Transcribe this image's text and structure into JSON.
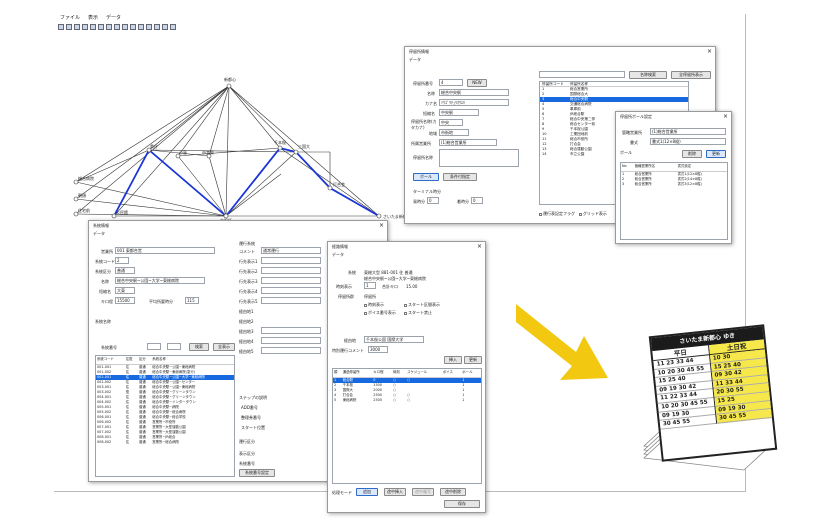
{
  "menubar": [
    "ファイル",
    "表示",
    "データ"
  ],
  "toolbar_icons": [
    "new-icon",
    "open-icon",
    "save-icon",
    "copy-icon",
    "cut-icon",
    "paste-icon",
    "settings-icon",
    "list-icon",
    "map-icon",
    "edit-icon",
    "delete-icon",
    "grid-icon",
    "search-icon",
    "window-icon",
    "user-icon"
  ],
  "map": {
    "nodes": {
      "n1": "新都心",
      "n2": "さいたま新都心",
      "n3": "千本桜",
      "n4": "三国大",
      "n5": "打合会",
      "n6": "市役所",
      "n7": "県庁",
      "n8": "小島",
      "n9": "市営東",
      "n10": "新都会場",
      "n11": "総合病院",
      "n12": "朝顔",
      "n13": "住宅前",
      "n14": "公民館",
      "n15": "総合運"
    }
  },
  "stop_dialog": {
    "title": "停留所情報",
    "subtitle": "データ",
    "fields": {
      "stop_no_label": "停留所番号",
      "stop_no": "4",
      "new_btn": "NEW",
      "name_label": "名称",
      "name": "総合中央駅",
      "kana_label": "カナ名",
      "kana": "ｿｳｺﾞｳﾁｭｳｵｳｴｷ",
      "short_label": "短縮名",
      "short": "中央駅",
      "short2_label": "停留所名称(カタカナ)",
      "short2": "中央",
      "region_label": "地域",
      "region": "市街地",
      "company_label": "所属営業所",
      "company": "(1)総合営業所",
      "note_label": "停留所名称"
    },
    "buttons": {
      "all": "ボール",
      "detail": "条件付指定"
    },
    "search_btn": "名称検索",
    "all_stops_btn": "全停留所表示",
    "bottom": {
      "label": "ターミナル時分",
      "arr_label": "発時分",
      "arr": "0",
      "dep_label": "着時分",
      "dep": "0"
    },
    "checks": [
      "運行表記定フラグ",
      "グリッド表示"
    ],
    "list_headers": [
      "停留所コード",
      "停留所名称"
    ],
    "list": [
      {
        "code": "1",
        "name": "総合営業所"
      },
      {
        "code": "2",
        "name": "国際総合大"
      },
      {
        "code": "3",
        "name": "総合中央駅"
      },
      {
        "code": "4",
        "name": "交通総合病院"
      },
      {
        "code": "5",
        "name": "車庫前"
      },
      {
        "code": "6",
        "name": "JR総合駅"
      },
      {
        "code": "7",
        "name": "総合中央第二停"
      },
      {
        "code": "8",
        "name": "総合センター前"
      },
      {
        "code": "9",
        "name": "千本桜公園"
      },
      {
        "code": "10",
        "name": "工業団地前"
      },
      {
        "code": "11",
        "name": "総合市役所"
      },
      {
        "code": "12",
        "name": "打合会"
      },
      {
        "code": "13",
        "name": "総合運動公園"
      },
      {
        "code": "14",
        "name": "市立公園"
      }
    ]
  },
  "pole_dialog": {
    "title": "停留所ポール設定",
    "company_label": "管轄営業所",
    "company": "(1)総合営業所",
    "pole_label": "書式",
    "pole": "書式1(12×8縦)",
    "tab": "ポール",
    "btn_delete": "削除",
    "btn_update": "更新",
    "headers": [
      "No",
      "管轄営業所名",
      "書式設定"
    ],
    "rows": [
      {
        "no": "1",
        "office": "総合営業所",
        "fmt": "書式1(12×8縦)"
      },
      {
        "no": "2",
        "office": "総合営業所",
        "fmt": "書式2(14×8縦)"
      },
      {
        "no": "3",
        "office": "総合営業所",
        "fmt": "書式3(12×8縦)"
      }
    ]
  },
  "route_dialog": {
    "title": "系統情報",
    "subtitle": "データ",
    "fields": {
      "office_label": "営業所",
      "office": "001 東都合営",
      "code_label": "系統コード",
      "code": "2",
      "kind_label": "系統区分",
      "kind": "普通",
      "name_label": "名称",
      "name": "総合中央駅~公園~大学~東総病院",
      "short_label": "短縮名",
      "short": "大東",
      "dist_label": "キロ程",
      "dist": "15500",
      "time_label": "平均所要時分",
      "time": "115"
    },
    "col_title": "系統名称",
    "search": {
      "label": "系統番号",
      "btn": "検索",
      "all": "全表示"
    },
    "headers": [
      "系統コード",
      "往復",
      "区分",
      "系統名称"
    ],
    "rows": [
      [
        "001-001",
        "往",
        "普通",
        "総合中央駅~公園~東総病院"
      ],
      [
        "001-002",
        "往",
        "普通",
        "総合中央駅~東総病院(急行)"
      ],
      [
        "002-001",
        "往",
        "普通",
        "総合中央駅~公園~大学~東総病院"
      ],
      [
        "002-002",
        "往",
        "普通",
        "総合中央駅~公園~センター"
      ],
      [
        "003-001",
        "往",
        "普通",
        "総合中央駅~公園~東総病院"
      ],
      [
        "003-002",
        "復",
        "普通",
        "総合中央駅~グリーンタウン"
      ],
      [
        "004-001",
        "往",
        "普通",
        "総合中央駅~グリーンタウン"
      ],
      [
        "004-002",
        "往",
        "普通",
        "総合中央駅~インタータウン"
      ],
      [
        "005-001",
        "往",
        "普通",
        "総合中央駅~病院"
      ],
      [
        "005-002",
        "往",
        "普通",
        "総合中央駅~総合病院"
      ],
      [
        "006-001",
        "往",
        "普通",
        "総合中央駅~総合学校"
      ],
      [
        "006-002",
        "往",
        "普通",
        "営業所~市役所"
      ],
      [
        "007-001",
        "往",
        "普通",
        "営業所~大型運動公園"
      ],
      [
        "007-002",
        "往",
        "普通",
        "営業所~大型運動公園"
      ],
      [
        "008-001",
        "往",
        "普通",
        "営業所~JR総合"
      ],
      [
        "008-002",
        "往",
        "普通",
        "営業所~総合病院"
      ]
    ],
    "right": {
      "group_title": "運行系統",
      "labels": [
        "コメント",
        "行先表示1",
        "行先表示2",
        "行先表示3",
        "行先表示4",
        "行先表示5",
        "経由地1",
        "経由地2",
        "経由地3",
        "経由地4",
        "経由地5"
      ],
      "comment": "通常運行",
      "via1": "千本桜公園 国際大学",
      "via2": "特急運行",
      "sub_title": "ステップの説明",
      "sub_fields": [
        "ADD番号",
        "整理券番号",
        "スタート位置"
      ],
      "footer": [
        "運行区分",
        "表示区分",
        "系統番号"
      ],
      "btn": "系統番号設定",
      "close_btn": "系統情報"
    }
  },
  "route_detail_dialog": {
    "title": "経路情報",
    "subtitle": "データ",
    "fields": {
      "office_label": "系統",
      "office": "東総大型 881-001 往 普通",
      "name": "総合中央駅~公園~大学~東総病院",
      "time_label": "時刻表示",
      "time": "1",
      "dist_label": "合計キロ",
      "dist": "15.00",
      "group_label": "停留所群",
      "group": "停留所"
    },
    "checks": [
      "時刻表示",
      "スタート区間表示",
      "ボイス番号表示",
      "スタート禁止"
    ],
    "via_label": "経由地",
    "via": "千本桜公園 国際大学",
    "comment_label": "特別運行コメント",
    "comment": "3000",
    "btn_insert": "挿入",
    "btn_update": "更新",
    "headers": [
      "順",
      "通過停留所",
      "キロ程",
      "時刻",
      "スケジュール",
      "ボイス",
      "ポール"
    ],
    "rows": [
      [
        "1",
        "総合駅",
        "0",
        "○",
        "○",
        "",
        "1"
      ],
      [
        "2",
        "千本桜",
        "1500",
        "○",
        "",
        "",
        "1"
      ],
      [
        "3",
        "国際大",
        "2000",
        "○",
        "",
        "",
        "1"
      ],
      [
        "4",
        "打合会",
        "2500",
        "○",
        "○",
        "",
        "1"
      ],
      [
        "5",
        "東総病院",
        "2500",
        "○",
        "○",
        "",
        "1"
      ]
    ],
    "footer": {
      "mode_label": "処理モード",
      "btn_new": "追加",
      "btn_insert2": "途中挿入",
      "btn_copy": "途中複写",
      "btn_delete": "途中削除",
      "btn_save": "保存"
    }
  },
  "timetable": {
    "header": "さいたま新都心 ゆき",
    "col_weekday": "平日",
    "col_holiday": "土日祝",
    "weekday": [
      "11 23 33 44",
      "10 20 30 45 55",
      "15 25 40",
      "09 19 30 42",
      "11 22 33 44",
      "10 20 30 45 55",
      "09 19 30",
      "30 45 55"
    ],
    "holiday": [
      "10 30",
      "15 25 40",
      "09 30 42",
      "11 33 44",
      "20 30 55",
      "15 25",
      "09 19 30",
      "30 45 55"
    ]
  }
}
